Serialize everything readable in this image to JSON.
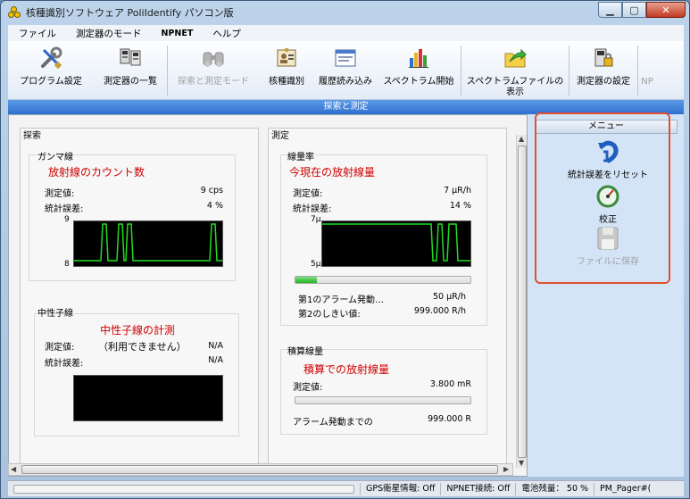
{
  "window": {
    "title": "核種識別ソフトウェア PoliIdentify パソコン版"
  },
  "menu": [
    "ファイル",
    "測定器のモード",
    "NPNET",
    "ヘルプ"
  ],
  "toolbar": [
    {
      "label": "プログラム設定",
      "icon": "wrench-screwdriver-icon",
      "enabled": true
    },
    {
      "label": "測定器の一覧",
      "icon": "device-list-icon",
      "enabled": true
    },
    {
      "label": "探索と測定モード",
      "icon": "binoculars-icon",
      "enabled": false
    },
    {
      "label": "核種識別",
      "icon": "id-card-icon",
      "enabled": true
    },
    {
      "label": "履歴読み込み",
      "icon": "history-window-icon",
      "enabled": true
    },
    {
      "label": "スペクトラム開始",
      "icon": "bar-chart-icon",
      "enabled": true
    },
    {
      "label": "スペクトラムファイルの表示",
      "icon": "folder-arrow-icon",
      "enabled": true
    },
    {
      "label": "測定器の設定",
      "icon": "device-lock-icon",
      "enabled": true
    },
    {
      "label": "NP",
      "icon": "npnet-icon",
      "enabled": false
    }
  ],
  "subheader": "探索と測定",
  "search": {
    "title": "探索",
    "gamma": {
      "title": "ガンマ線",
      "annotation": "放射線のカウント数",
      "measured_label": "測定値:",
      "measured_value": "9 cps",
      "error_label": "統計誤差:",
      "error_value": "4 %",
      "axis_top": "9",
      "axis_bottom": "8"
    },
    "neutron": {
      "title": "中性子線",
      "annotation": "中性子線の計測",
      "note": "（利用できません）",
      "measured_label": "測定値:",
      "measured_value": "N/A",
      "error_label": "統計誤差:",
      "error_value": "N/A"
    }
  },
  "measure": {
    "title": "測定",
    "doserate": {
      "title": "線量率",
      "annotation": "今現在の放射線量",
      "measured_label": "測定値:",
      "measured_value": "7 μR/h",
      "error_label": "統計誤差:",
      "error_value": "14 %",
      "axis_top": "7μ",
      "axis_bottom": "5μ",
      "progress": 0.12,
      "alarm1_label": "第1のアラーム発動…",
      "alarm1_value": "50 μR/h",
      "alarm2_label": "第2のしきい値:",
      "alarm2_value": "999.000 R/h"
    },
    "accumulated": {
      "title": "積算線量",
      "annotation": "積算での放射線量",
      "measured_label": "測定値:",
      "measured_value": "3.800 mR",
      "progress": 0.0,
      "alarm_label": "アラーム発動までの",
      "alarm_value": "999.000 R"
    }
  },
  "sidebar": {
    "title": "メニュー",
    "items": [
      {
        "label": "統計誤差をリセット",
        "icon": "reset-arrow-icon",
        "enabled": true
      },
      {
        "label": "校正",
        "icon": "calibration-gauge-icon",
        "enabled": true
      },
      {
        "label": "ファイルに保存",
        "icon": "floppy-disk-icon",
        "enabled": false
      }
    ]
  },
  "status": {
    "gps": "GPS衛星情報: Off",
    "npnet": "NPNET接続: Off",
    "battery": "電池残量： 50 %",
    "pager": "PM_Pager#("
  },
  "colors": {
    "accent": "#2f6fcf",
    "annotation": "#d00000",
    "trace": "#22dd22",
    "highlight": "#e05030"
  }
}
